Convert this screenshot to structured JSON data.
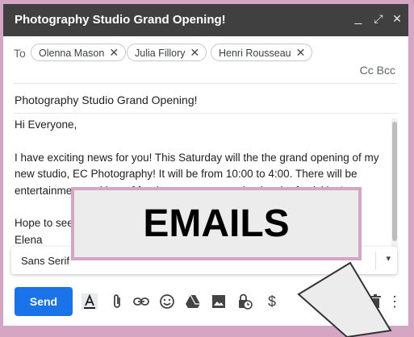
{
  "window": {
    "title": "Photography Studio Grand Opening!",
    "controls": [
      "minimize-icon",
      "expand-icon",
      "close-icon"
    ],
    "control_glyphs": {
      "minimize": "_",
      "expand": "⤢",
      "close": "✕"
    }
  },
  "recipients": {
    "label": "To",
    "chips": [
      "Olenna Mason",
      "Julia Fillory",
      "Henri Rousseau"
    ],
    "remove_glyph": "✕",
    "cc_bcc": "Cc Bcc"
  },
  "subject": "Photography Studio Grand Opening!",
  "body": {
    "greeting": "Hi Everyone,",
    "paragraph_1": "I have exciting news for you! This Saturday will the the grand opening of my new studio, EC Photography! It will be from 10:00 to 4:00. There will be entertainment and lots of food, so come out and enjoy the festivities!",
    "line_hope": "Hope to see you there!",
    "signature": "Elena"
  },
  "formatting": {
    "font": "Sans Serif",
    "dropdown_glyph": "▾"
  },
  "toolbar": {
    "send_label": "Send",
    "icons": [
      "text-format-icon",
      "attach-icon",
      "link-icon",
      "emoji-icon",
      "drive-icon",
      "photo-icon",
      "confidential-icon",
      "money-icon",
      "trash-icon",
      "more-options-icon"
    ],
    "money_glyph": "$",
    "more_glyph": "⋮"
  },
  "overlay": {
    "label": "EMAILS"
  },
  "colors": {
    "frame": "#d5a6c4",
    "titlebar": "#404040",
    "send": "#1a73e8",
    "overlay_bg": "#ececec"
  }
}
